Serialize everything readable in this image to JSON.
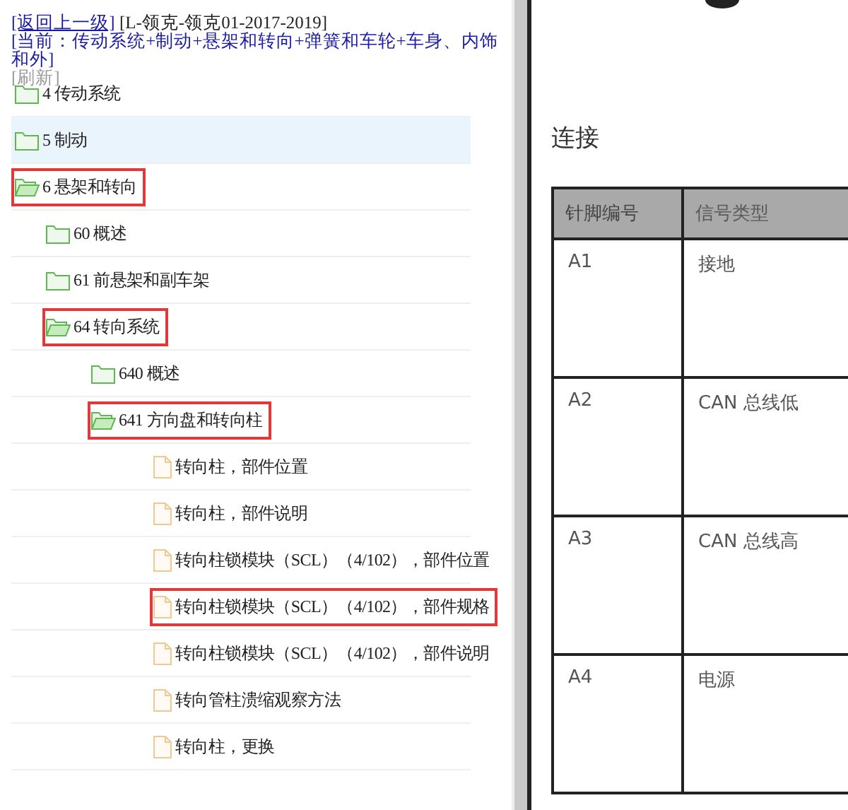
{
  "header": {
    "back_link": "[返回上一级]",
    "model": "[L-领克-领克01-2017-2019]",
    "current_path": "[当前：传动系统+制动+悬架和转向+弹簧和车轮+车身、内饰和外]",
    "refresh_link": "[刷新]"
  },
  "tree": [
    {
      "kind": "folder",
      "label": "4 传动系统",
      "expanded": false,
      "selected": false,
      "marked": false
    },
    {
      "kind": "folder",
      "label": "5 制动",
      "expanded": false,
      "selected": true,
      "marked": false
    },
    {
      "kind": "folder",
      "label": "6 悬架和转向",
      "expanded": true,
      "selected": false,
      "marked": true,
      "children": [
        {
          "kind": "folder",
          "label": "60 概述",
          "expanded": false,
          "selected": false,
          "marked": false
        },
        {
          "kind": "folder",
          "label": "61 前悬架和副车架",
          "expanded": false,
          "selected": false,
          "marked": false
        },
        {
          "kind": "folder",
          "label": "64 转向系统",
          "expanded": true,
          "selected": false,
          "marked": true,
          "children": [
            {
              "kind": "folder",
              "label": "640 概述",
              "expanded": false,
              "selected": false,
              "marked": false
            },
            {
              "kind": "folder",
              "label": "641 方向盘和转向柱",
              "expanded": true,
              "selected": false,
              "marked": true,
              "children": [
                {
                  "kind": "document",
                  "label": "转向柱，部件位置",
                  "selected": false,
                  "marked": false
                },
                {
                  "kind": "document",
                  "label": "转向柱，部件说明",
                  "selected": false,
                  "marked": false
                },
                {
                  "kind": "document",
                  "label": "转向柱锁模块（SCL）（4/102），部件位置",
                  "selected": false,
                  "marked": false
                },
                {
                  "kind": "document",
                  "label": "转向柱锁模块（SCL）（4/102），部件规格",
                  "selected": false,
                  "marked": true
                },
                {
                  "kind": "document",
                  "label": "转向柱锁模块（SCL）（4/102），部件说明",
                  "selected": false,
                  "marked": false
                },
                {
                  "kind": "document",
                  "label": "转向管柱溃缩观察方法",
                  "selected": false,
                  "marked": false
                },
                {
                  "kind": "document",
                  "label": "转向柱，更换",
                  "selected": false,
                  "marked": false
                }
              ]
            }
          ]
        }
      ]
    }
  ],
  "document": {
    "heading": "连接",
    "table": {
      "columns": [
        "针脚编号",
        "信号类型"
      ],
      "rows": [
        {
          "pin": "A1",
          "signal": "接地"
        },
        {
          "pin": "A2",
          "signal": "CAN 总线低"
        },
        {
          "pin": "A3",
          "signal": "CAN 总线高"
        },
        {
          "pin": "A4",
          "signal": "电源"
        }
      ]
    }
  }
}
